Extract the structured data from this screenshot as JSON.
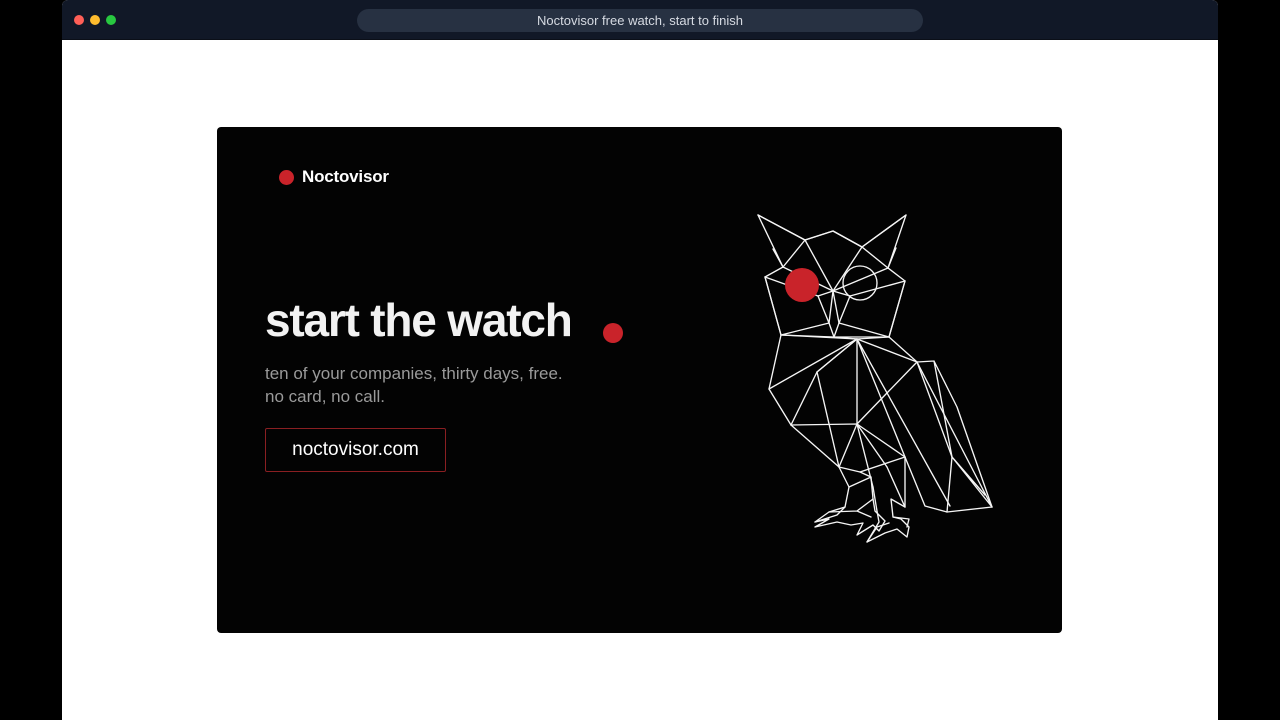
{
  "window": {
    "address_bar_text": "Noctovisor free watch, start to finish"
  },
  "hero": {
    "brand_name": "Noctovisor",
    "headline": "start the watch",
    "subline_1": "ten of your companies, thirty days, free.",
    "subline_2": "no card, no call.",
    "cta_url": "noctovisor.com"
  },
  "colors": {
    "accent_red": "#c9232a",
    "titlebar": "#111827",
    "hero_background": "#030303"
  },
  "icons": {
    "brand_mark": "red-dot-icon",
    "illustration": "geometric-owl-icon"
  }
}
